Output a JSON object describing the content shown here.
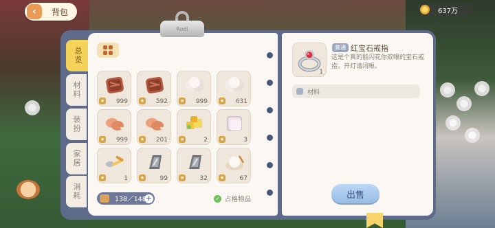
{
  "header": {
    "back_label": "背包",
    "currency": "637万"
  },
  "clip_text": "Rodi",
  "tabs": [
    {
      "label": "总览",
      "active": true
    },
    {
      "label": "材料",
      "active": false
    },
    {
      "label": "装扮",
      "active": false
    },
    {
      "label": "家居",
      "active": false
    },
    {
      "label": "消耗",
      "active": false
    }
  ],
  "items": [
    {
      "icon": "meat-steak-icon",
      "count": "999"
    },
    {
      "icon": "meat-steak-icon",
      "count": "592"
    },
    {
      "icon": "cotton-icon",
      "count": "999"
    },
    {
      "icon": "cotton-icon",
      "count": "631"
    },
    {
      "icon": "chicken-leg-icon",
      "count": "999"
    },
    {
      "icon": "chicken-leg-icon",
      "count": "201"
    },
    {
      "icon": "cheese-icon",
      "count": "2"
    },
    {
      "icon": "cloth-icon",
      "count": "3"
    },
    {
      "icon": "tools-icon",
      "count": "1"
    },
    {
      "icon": "iron-ingot-icon",
      "count": "99"
    },
    {
      "icon": "iron-ingot-icon",
      "count": "32"
    },
    {
      "icon": "rice-bowl-icon",
      "count": "67"
    }
  ],
  "capacity": "138／148",
  "equipped_label": "占格物品",
  "detail": {
    "badge": "普通",
    "name": "红宝石戒指",
    "description": "这是个真的能闪花你双眼的宝石戒指，开灯请闭眼。",
    "count": "1",
    "tag": "材料",
    "sell_label": "出售"
  },
  "colors": {
    "accent": "#f5d25a",
    "panel": "#5e6a8a",
    "sell": "#98bde6"
  }
}
